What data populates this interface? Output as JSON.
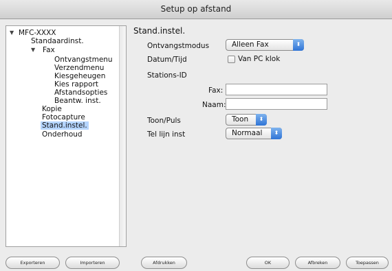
{
  "window": {
    "title": "Setup op afstand"
  },
  "tree": {
    "root": "MFC-XXXX",
    "items": [
      "Standaardinst.",
      "Fax",
      "Ontvangstmenu",
      "Verzendmenu",
      "Kiesgeheugen",
      "Kies rapport",
      "Afstandsopties",
      "Beantw. inst.",
      "Kopie",
      "Fotocapture",
      "Stand.instel.",
      "Onderhoud"
    ],
    "selected": "Stand.instel."
  },
  "panel": {
    "title": "Stand.instel.",
    "receive_mode_label": "Ontvangstmodus",
    "receive_mode_value": "Alleen Fax",
    "date_time_label": "Datum/Tijd",
    "pc_clock_label": "Van PC klok",
    "station_id_label": "Stations-ID",
    "fax_label": "Fax:",
    "fax_value": "",
    "name_label": "Naam:",
    "name_value": "",
    "tone_pulse_label": "Toon/Puls",
    "tone_pulse_value": "Toon",
    "line_label": "Tel lijn inst",
    "line_value": "Normaal"
  },
  "buttons": {
    "export": "Exporteren",
    "import": "Importeren",
    "print": "Afdrukken",
    "ok": "OK",
    "cancel": "Afbreken",
    "apply": "Toepassen"
  }
}
